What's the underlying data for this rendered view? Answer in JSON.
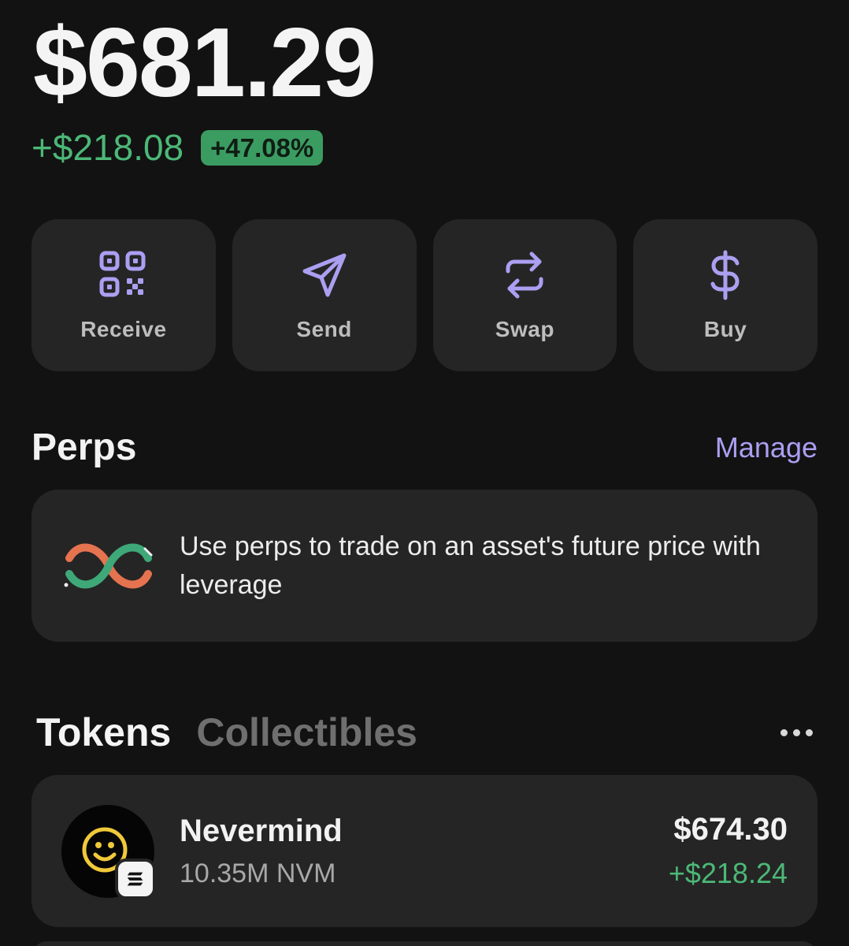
{
  "portfolio": {
    "balance": "$681.29",
    "change_amount": "+$218.08",
    "change_percent": "+47.08%"
  },
  "actions": [
    {
      "label": "Receive",
      "icon": "qr-code-icon"
    },
    {
      "label": "Send",
      "icon": "send-icon"
    },
    {
      "label": "Swap",
      "icon": "swap-icon"
    },
    {
      "label": "Buy",
      "icon": "dollar-icon"
    }
  ],
  "perps": {
    "title": "Perps",
    "manage_label": "Manage",
    "description": "Use perps to trade on an asset's future price with leverage",
    "icon": "infinity-icon"
  },
  "tabs": {
    "tokens": "Tokens",
    "collectibles": "Collectibles",
    "more_icon": "more-icon"
  },
  "tokens": [
    {
      "name": "Nevermind",
      "amount": "10.35M NVM",
      "value": "$674.30",
      "change": "+$218.24",
      "chain_icon": "solana-icon"
    }
  ],
  "colors": {
    "accent": "#ab9ff2",
    "positive": "#4cb877",
    "badge": "#3b9c61",
    "card": "#252525",
    "background": "#121212"
  }
}
